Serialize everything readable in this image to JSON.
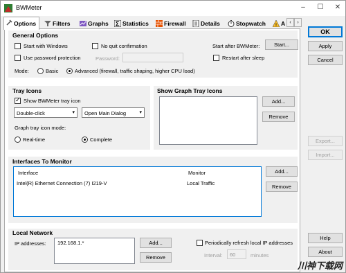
{
  "window": {
    "title": "BWMeter",
    "minimize": "–",
    "maximize": "☐",
    "close": "✕"
  },
  "tabs": [
    {
      "label": "Options",
      "icon": "wrench-icon"
    },
    {
      "label": "Filters",
      "icon": "filter-icon"
    },
    {
      "label": "Graphs",
      "icon": "graph-icon"
    },
    {
      "label": "Statistics",
      "icon": "sigma-icon"
    },
    {
      "label": "Firewall",
      "icon": "firewall-icon"
    },
    {
      "label": "Details",
      "icon": "details-icon"
    },
    {
      "label": "Stopwatch",
      "icon": "stopwatch-icon"
    },
    {
      "label": "A",
      "icon": "alert-icon"
    }
  ],
  "tab_scroll": {
    "left": "‹",
    "right": "›"
  },
  "general": {
    "title": "General Options",
    "start_windows": "Start with Windows",
    "no_quit": "No quit confirmation",
    "start_after": "Start after BWMeter:",
    "start_btn": "Start...",
    "use_password": "Use password protection",
    "password_label": "Password:",
    "restart_sleep": "Restart after sleep",
    "mode_label": "Mode:",
    "mode_basic": "Basic",
    "mode_advanced": "Advanced (firewall, traffic shaping, higher CPU load)"
  },
  "tray": {
    "title": "Tray Icons",
    "show_icon": "Show BWMeter tray icon",
    "click_value": "Double-click",
    "action_value": "Open Main Dialog",
    "graph_mode_label": "Graph tray icon mode:",
    "realtime": "Real-time",
    "complete": "Complete"
  },
  "graph_tray": {
    "title": "Show Graph Tray Icons",
    "add": "Add...",
    "remove": "Remove"
  },
  "interfaces": {
    "title": "Interfaces To Monitor",
    "col_interface": "Interface",
    "col_monitor": "Monitor",
    "row_interface": "Intel(R) Ethernet Connection (7) I219-V",
    "row_monitor": "Local Traffic",
    "add": "Add...",
    "remove": "Remove"
  },
  "local": {
    "title": "Local Network",
    "ip_label": "IP addresses:",
    "ip_value": "192.168.1.*",
    "add": "Add...",
    "remove": "Remove",
    "refresh": "Periodically refresh local IP addresses",
    "interval_label": "Interval:",
    "interval_value": "60",
    "minutes": "minutes"
  },
  "side": {
    "ok": "OK",
    "apply": "Apply",
    "cancel": "Cancel",
    "export": "Export...",
    "import": "Import...",
    "help": "Help",
    "about": "About"
  },
  "watermark": "川神下载网"
}
